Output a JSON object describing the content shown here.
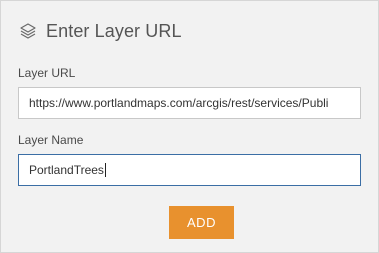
{
  "header": {
    "title": "Enter Layer URL",
    "icon": "layers-icon"
  },
  "form": {
    "url_label": "Layer URL",
    "url_value": "https://www.portlandmaps.com/arcgis/rest/services/Publi",
    "name_label": "Layer Name",
    "name_value": "PortlandTrees"
  },
  "actions": {
    "add_label": "ADD"
  },
  "colors": {
    "accent": "#e8912e",
    "focus_border": "#3b6ea5"
  }
}
